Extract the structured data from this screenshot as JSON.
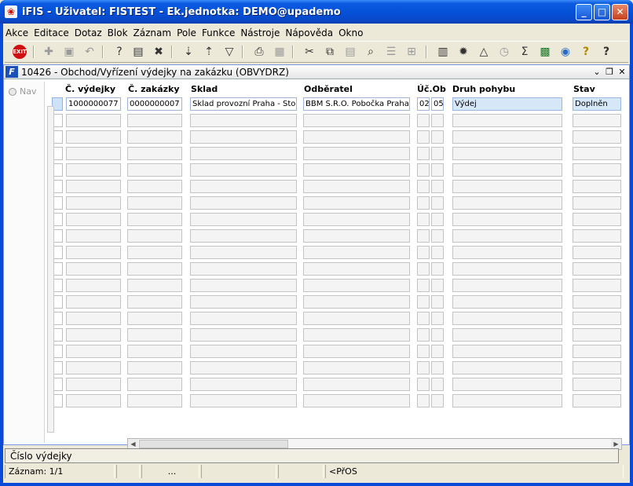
{
  "window": {
    "title": "iFIS - Uživatel: FISTEST - Ek.jednotka: DEMO@upademo",
    "app_icon": "ifis-app-icon",
    "controls": [
      "_",
      "□",
      "✕"
    ]
  },
  "menu": {
    "items": [
      "Akce",
      "Editace",
      "Dotaz",
      "Blok",
      "Záznam",
      "Pole",
      "Funkce",
      "Nástroje",
      "Nápověda",
      "Okno"
    ]
  },
  "toolbar": {
    "exit_label": "EXIT",
    "icons": [
      "exit-icon",
      "insert-record-icon",
      "save-icon",
      "undo-icon",
      "query-enter-icon",
      "query-execute-icon",
      "query-cancel-icon",
      "sort-ascending-icon",
      "sort-descending-icon",
      "filter-icon",
      "print-icon",
      "print-preview-icon",
      "cut-icon",
      "copy-icon",
      "paste-icon",
      "search-icon",
      "list-icon",
      "tree-icon",
      "calculator-icon",
      "settings-icon",
      "chart-icon",
      "clock-icon",
      "sum-icon",
      "excel-icon",
      "web-icon",
      "help-question-icon",
      "context-help-icon"
    ]
  },
  "form": {
    "title": "10426 - Obchod/Vyřízení výdejky na zakázku (OBVYDRZ)",
    "nav_label": "Nav",
    "columns": [
      {
        "key": "vydejka",
        "label": "Č. výdejky"
      },
      {
        "key": "zakazka",
        "label": "Č. zakázky"
      },
      {
        "key": "sklad",
        "label": "Sklad"
      },
      {
        "key": "odberatel",
        "label": "Odběratel"
      },
      {
        "key": "uc",
        "label": "Úč.Ob"
      },
      {
        "key": "ob",
        "label": ""
      },
      {
        "key": "druh",
        "label": "Druh pohybu"
      },
      {
        "key": "stav",
        "label": "Stav"
      }
    ],
    "rows": [
      [
        "1000000077",
        "0000000007",
        "Sklad provozní Praha - Sto",
        "BBM S.R.O. Pobočka Praha",
        "02",
        "05",
        "Výdej",
        "Doplněn"
      ]
    ],
    "empty_rows": 18
  },
  "status": {
    "field_hint": "Číslo výdejky",
    "record": "Záznam: 1/1",
    "seg3": "...",
    "mode": "<PřOS"
  }
}
